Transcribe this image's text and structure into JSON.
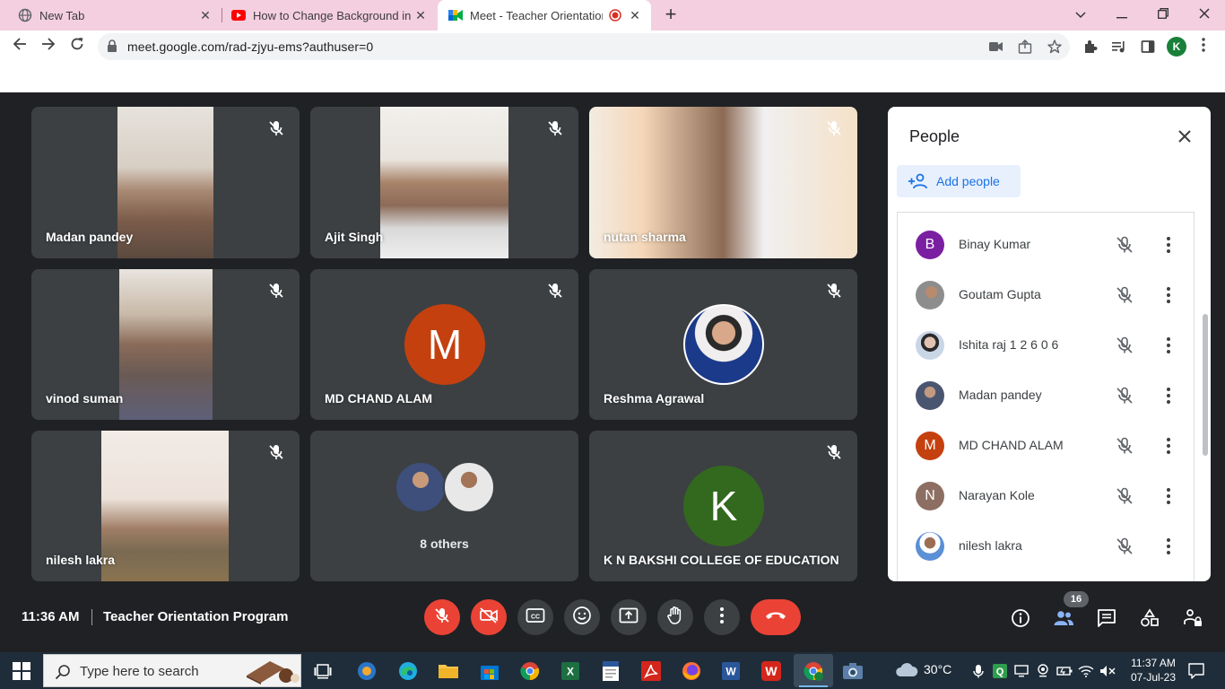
{
  "browser": {
    "tabs": [
      {
        "title": "New Tab"
      },
      {
        "title": "How to Change Background in G"
      },
      {
        "title": "Meet - Teacher Orientation P"
      }
    ],
    "url": "meet.google.com/rad-zjyu-ems?authuser=0",
    "profile_initial": "K"
  },
  "meet": {
    "tiles": [
      {
        "name": "Madan pandey"
      },
      {
        "name": "Ajit Singh"
      },
      {
        "name": "nutan sharma"
      },
      {
        "name": "vinod suman"
      },
      {
        "name": "MD CHAND ALAM",
        "initial": "M"
      },
      {
        "name": "Reshma Agrawal"
      },
      {
        "name": "nilesh lakra"
      },
      {
        "name": "8 others"
      },
      {
        "name": "K N BAKSHI COLLEGE OF EDUCATION",
        "initial": "K"
      }
    ],
    "people_panel": {
      "title": "People",
      "add_label": "Add people",
      "list": [
        {
          "name": "Binay Kumar",
          "initial": "B",
          "color": "#7b1fa2"
        },
        {
          "name": "Goutam Gupta",
          "initial": "",
          "color": "#8d8d8d"
        },
        {
          "name": "Ishita raj 1 2 6 0 6",
          "initial": "",
          "color": "#b0b0b0"
        },
        {
          "name": "Madan pandey",
          "initial": "",
          "color": "#9e9e9e"
        },
        {
          "name": "MD CHAND ALAM",
          "initial": "M",
          "color": "#c5400f"
        },
        {
          "name": "Narayan Kole",
          "initial": "N",
          "color": "#8d6e63"
        },
        {
          "name": "nilesh lakra",
          "initial": "",
          "color": "#5b8fd6"
        }
      ]
    },
    "bottom": {
      "time": "11:36 AM",
      "meeting_name": "Teacher Orientation Program",
      "people_count": "16"
    }
  },
  "taskbar": {
    "search_placeholder": "Type here to search",
    "weather": "30°C",
    "time": "11:37 AM",
    "date": "07-Jul-23"
  }
}
